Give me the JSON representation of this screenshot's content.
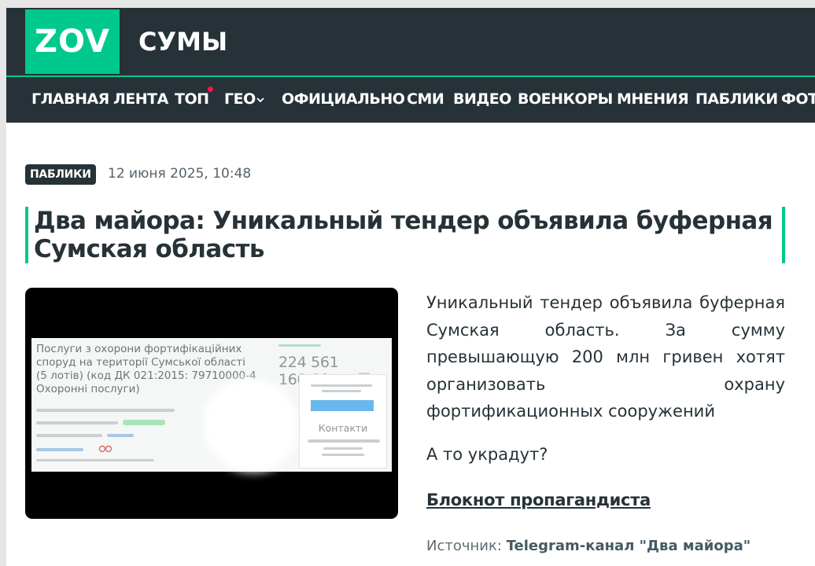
{
  "header": {
    "logo_text": "ZOV",
    "site_name": "СУМЫ"
  },
  "nav": {
    "items": [
      "ГЛАВНАЯ",
      "ЛЕНТА",
      "ТОП",
      "ГЕО",
      "ОФИЦИАЛЬНО",
      "СМИ",
      "ВИДЕО",
      "ВОЕНКОРЫ",
      "МНЕНИЯ",
      "ПАБЛИКИ",
      "ФОТ"
    ]
  },
  "article": {
    "category": "ПАБЛИКИ",
    "date": "12 июня 2025, 10:48",
    "title": "Два майора: Уникальный тендер объявила буферная Сумская область",
    "paragraph1": "Уникальный тендер объявила буферная Сумская область. За сумму превышающую 200 млн гривен хотят организовать охрану фортификационных сооружений",
    "paragraph2": "А то украдут?",
    "link_label": "Блокнот пропагандиста",
    "source_label": "Источник:",
    "source_name": "Telegram-канал \"Два майора\""
  },
  "image": {
    "tender_title": "Послуги з охорони фортифікаційних споруд на території Сумської області (5 лотів) (код ДК 021:2015: 79710000-4 Охоронні послуги)",
    "amount": "224 561 160,00",
    "contacts_label": "Контакти"
  },
  "colors": {
    "accent": "#00c98d",
    "header_bg": "#263238",
    "nav_dot": "#ff1744"
  }
}
